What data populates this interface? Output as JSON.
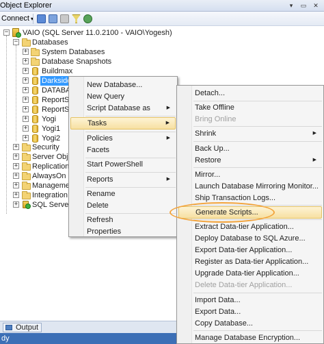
{
  "window": {
    "title": "Object Explorer",
    "pin_glyph": "▾",
    "autohide_glyph": "▭",
    "close_glyph": "✕"
  },
  "toolbar": {
    "connect_label": "Connect",
    "connect_dropdown_glyph": "▾",
    "icons": [
      "connect-object-explorer-icon",
      "disconnect-icon",
      "stop-icon",
      "filter-icon",
      "refresh-icon"
    ]
  },
  "tree": {
    "expand_glyph": "+",
    "collapse_glyph": "−",
    "server": "VAIO (SQL Server 11.0.2100 - VAIO\\Yogesh)",
    "databases": "Databases",
    "db_children": [
      "System Databases",
      "Database Snapshots",
      "Buildmax",
      "DarksideD",
      "DATABAS",
      "ReportSer",
      "ReportSer",
      "Yogi",
      "Yogi1",
      "Yogi2"
    ],
    "server_children": [
      "Security",
      "Server Object",
      "Replication",
      "AlwaysOn Hi",
      "Management",
      "Integration S",
      "SQL Server Ag"
    ]
  },
  "context_menu": {
    "items": [
      "New Database...",
      "New Query",
      "Script Database as",
      "Tasks",
      "Policies",
      "Facets",
      "Start PowerShell",
      "Reports",
      "Rename",
      "Delete",
      "Refresh",
      "Properties"
    ],
    "submenu_arrow": "▶"
  },
  "tasks_submenu": {
    "items": [
      "Detach...",
      "Take Offline",
      "Bring Online",
      "Shrink",
      "Back Up...",
      "Restore",
      "Mirror...",
      "Launch Database Mirroring Monitor...",
      "Ship Transaction Logs...",
      "Generate Scripts...",
      "Extract Data-tier Application...",
      "Deploy Database to SQL Azure...",
      "Export Data-tier Application...",
      "Register as Data-tier Application...",
      "Upgrade Data-tier Application...",
      "Delete Data-tier Application...",
      "Import Data...",
      "Export Data...",
      "Copy Database...",
      "Manage Database Encryption..."
    ],
    "submenu_arrow": "▶"
  },
  "output": {
    "label": "Output"
  },
  "status": {
    "text": "dy"
  },
  "colors": {
    "selection": "#3399ff",
    "highlight_ring": "#f3a43c",
    "status_bar": "#3c6fb6"
  }
}
